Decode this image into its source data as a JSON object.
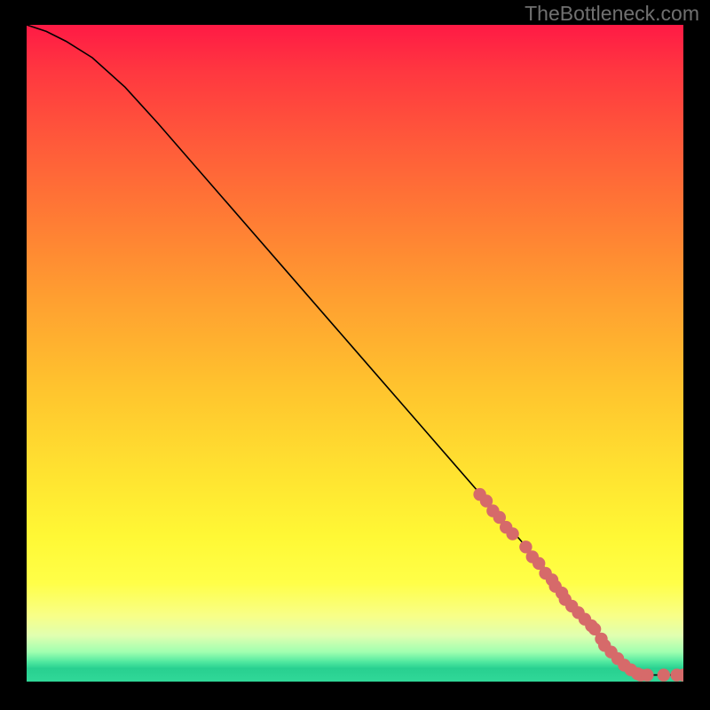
{
  "watermark": "TheBottleneck.com",
  "chart_data": {
    "type": "line",
    "title": "",
    "xlabel": "",
    "ylabel": "",
    "xlim": [
      0,
      100
    ],
    "ylim": [
      0,
      100
    ],
    "line": {
      "x": [
        0,
        3,
        6,
        10,
        15,
        20,
        30,
        40,
        50,
        60,
        70,
        80,
        85,
        88,
        91,
        94,
        100
      ],
      "y": [
        100,
        99,
        97.5,
        95,
        90.5,
        85,
        73.5,
        62,
        50.5,
        39,
        27.5,
        16,
        9.5,
        5.5,
        2.5,
        1,
        1
      ]
    },
    "markers": {
      "x": [
        69,
        70,
        71,
        72,
        73,
        74,
        76,
        77,
        78,
        79,
        80,
        80.5,
        81.5,
        82,
        83,
        84,
        85,
        86,
        86.5,
        87.5,
        88,
        89,
        90,
        91,
        92,
        93,
        93.5,
        94.5,
        97,
        99,
        100
      ],
      "y": [
        28.5,
        27.5,
        26,
        25,
        23.5,
        22.5,
        20.5,
        19,
        18,
        16.5,
        15.5,
        14.5,
        13.5,
        12.5,
        11.5,
        10.5,
        9.5,
        8.5,
        8,
        6.5,
        5.5,
        4.5,
        3.5,
        2.5,
        1.8,
        1.2,
        1,
        1,
        1,
        1,
        1
      ]
    }
  }
}
